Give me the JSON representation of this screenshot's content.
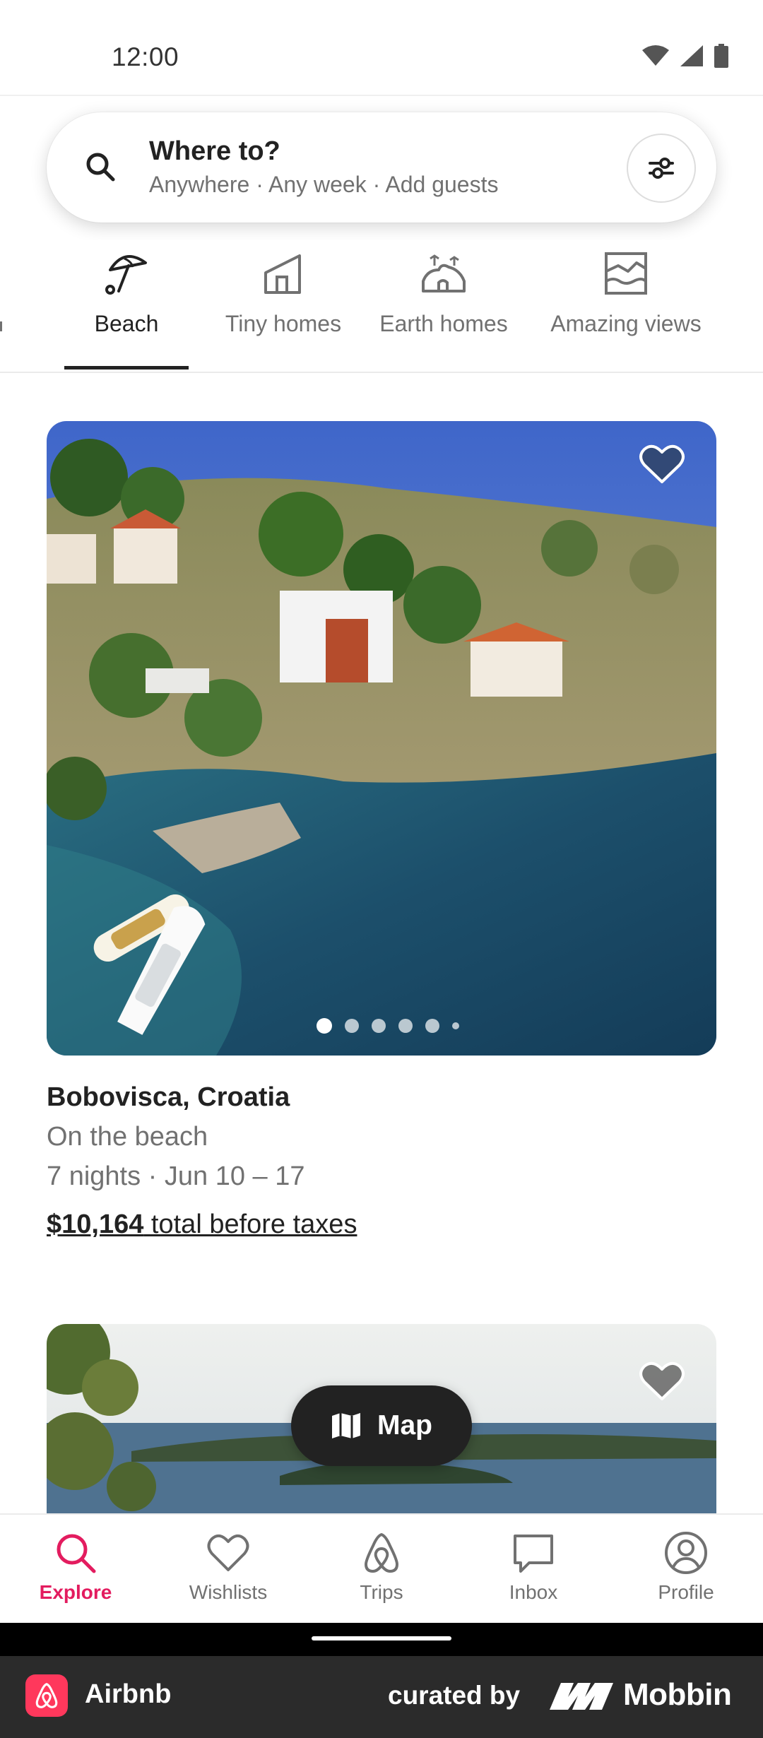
{
  "status_bar": {
    "time": "12:00"
  },
  "search": {
    "title": "Where to?",
    "subtitle": "Anywhere · Any week · Add guests"
  },
  "categories": [
    {
      "label": "Beach",
      "icon": "beach-umbrella-icon",
      "active": true
    },
    {
      "label": "Tiny homes",
      "icon": "tiny-home-icon",
      "active": false
    },
    {
      "label": "Earth homes",
      "icon": "earth-home-icon",
      "active": false
    },
    {
      "label": "Amazing views",
      "icon": "amazing-views-icon",
      "active": false
    }
  ],
  "listings": [
    {
      "location": "Bobovisca, Croatia",
      "description": "On the beach",
      "dates": "7 nights · Jun 10 – 17",
      "price": "$10,164",
      "price_suffix": " total before taxes",
      "photo_count_visible": 6,
      "active_photo": 1
    }
  ],
  "map_button": {
    "label": "Map"
  },
  "bottom_nav": [
    {
      "label": "Explore",
      "icon": "search-icon",
      "active": true
    },
    {
      "label": "Wishlists",
      "icon": "heart-icon",
      "active": false
    },
    {
      "label": "Trips",
      "icon": "airbnb-trips-icon",
      "active": false
    },
    {
      "label": "Inbox",
      "icon": "chat-bubble-icon",
      "active": false
    },
    {
      "label": "Profile",
      "icon": "profile-icon",
      "active": false
    }
  ],
  "footer": {
    "app_name": "Airbnb",
    "curated_by": "curated by",
    "brand": "Mobbin"
  },
  "colors": {
    "accent": "#E31C5F",
    "text_primary": "#222222",
    "text_secondary": "#717171",
    "airbnb_brand": "#FF385C"
  }
}
